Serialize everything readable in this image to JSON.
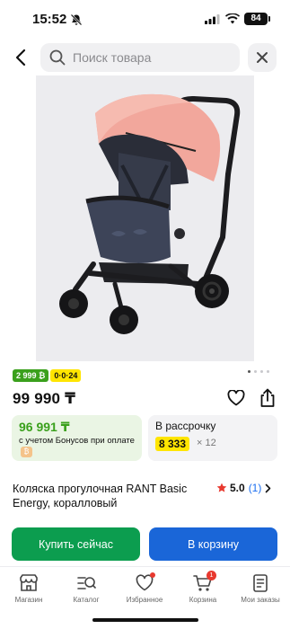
{
  "status_bar": {
    "time": "15:52",
    "battery": "84"
  },
  "search": {
    "placeholder": "Поиск товара"
  },
  "badges": {
    "bonus": "2 999 ₿",
    "installment": "0·0·24"
  },
  "product": {
    "price": "99 990 ₸",
    "title": "Коляска прогулочная RANT Basic Energy, коралловый",
    "rating": "5.0",
    "reviews": "(1)",
    "image_dots": 4
  },
  "bonus_card": {
    "price": "96 991 ₸",
    "note": "с учетом Бонусов при оплате"
  },
  "install_card": {
    "label": "В рассрочку",
    "amount": "8 333",
    "multiplier": "× 12"
  },
  "actions": {
    "buy_now": "Купить сейчас",
    "add_to_cart": "В корзину"
  },
  "nav": {
    "items": [
      {
        "label": "Магазин",
        "icon": "shop-icon"
      },
      {
        "label": "Каталог",
        "icon": "catalog-icon"
      },
      {
        "label": "Избранное",
        "icon": "heart-icon"
      },
      {
        "label": "Корзина",
        "icon": "cart-icon",
        "count": "1"
      },
      {
        "label": "Мои заказы",
        "icon": "orders-icon"
      }
    ]
  },
  "colors": {
    "green": "#0c9d4f",
    "blue": "#1a66d8",
    "yellow": "#ffe500",
    "stroller_coral": "#f2a79c"
  }
}
